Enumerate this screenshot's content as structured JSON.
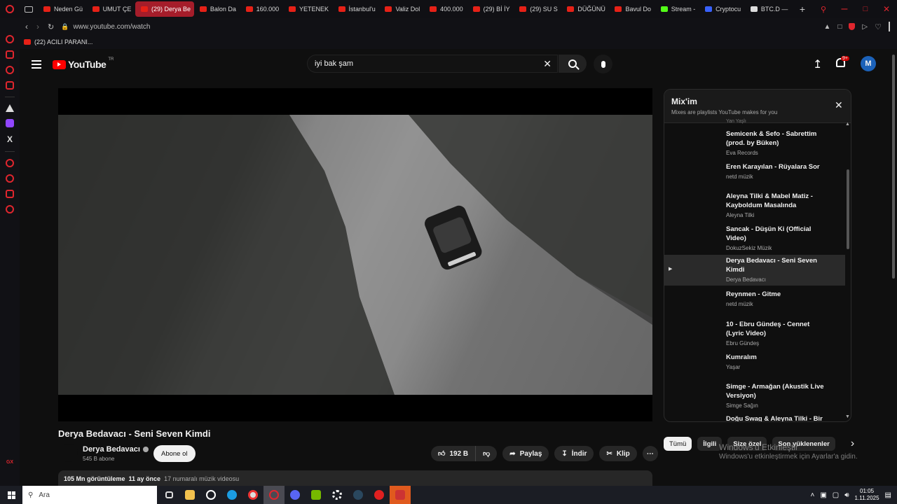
{
  "browser": {
    "tabs": [
      {
        "label": "Neden Gü"
      },
      {
        "label": "UMUT ÇE"
      },
      {
        "label": "(29) Derya Be",
        "active": true
      },
      {
        "label": "Balon Da"
      },
      {
        "label": "160.000"
      },
      {
        "label": "YETENEK"
      },
      {
        "label": "İstanbul'u"
      },
      {
        "label": "Valiz Dol"
      },
      {
        "label": "400.000"
      },
      {
        "label": "(29) Bİ İY"
      },
      {
        "label": "(29) SU S"
      },
      {
        "label": "DÜĞÜNÜ"
      },
      {
        "label": "Bavul Do"
      },
      {
        "label": "Stream -"
      },
      {
        "label": "Cryptocu"
      },
      {
        "label": "BTC.D —"
      }
    ],
    "url": "www.youtube.com/watch",
    "bookmark": "(22) ACILI PARANI..."
  },
  "youtube": {
    "logo_text": "YouTube",
    "region": "TR",
    "search_value": "iyi bak şam",
    "notification_badge": "9+",
    "avatar_letter": "M"
  },
  "video": {
    "title": "Derya Bedavacı - Seni Seven Kimdi",
    "channel": "Derya Bedavacı",
    "subscribers": "545 B abone",
    "subscribe_label": "Abone ol",
    "likes": "192 B",
    "share_label": "Paylaş",
    "download_label": "İndir",
    "clip_label": "Klip",
    "views": "105 Mn görüntüleme",
    "age": "11 ay önce",
    "rank": "17 numaralı müzik videosu"
  },
  "mix": {
    "title": "Mix'im",
    "subtitle": "Mixes are playlists YouTube makes for you",
    "partial_top": "Yan Yaşlı",
    "items": [
      {
        "title": "Semicenk & Sefo - Sabrettim (prod. by Büken)",
        "channel": "Eva Records",
        "current": false
      },
      {
        "title": "Eren Karayılan - Rüyalara Sor",
        "channel": "netd müzik",
        "current": false
      },
      {
        "title": "Aleyna Tilki & Mabel Matiz - Kayboldum Masalında",
        "channel": "Aleyna Tilki",
        "current": false
      },
      {
        "title": "Sancak - Düşün Ki (Official Video)",
        "channel": "DokuzSekiz Müzik",
        "current": false
      },
      {
        "title": "Derya Bedavacı - Seni Seven Kimdi",
        "channel": "Derya Bedavacı",
        "current": true
      },
      {
        "title": "Reynmen - Gitme",
        "channel": "netd müzik",
        "current": false
      },
      {
        "title": "10 - Ebru Gündeş - Cennet (Lyric Video)",
        "channel": "Ebru Gündeş",
        "current": false
      },
      {
        "title": "Kumralım",
        "channel": "Yaşar",
        "current": false
      },
      {
        "title": "Simge - Armağan (Akustik Live Versiyon)",
        "channel": "Simge Sağın",
        "current": false
      },
      {
        "title": "Doğu Swag & Aleyna Tilki - Bir",
        "channel": "",
        "current": false
      }
    ]
  },
  "chips": [
    "Tümü",
    "İlgili",
    "Size özel",
    "Son yüklenenler"
  ],
  "watermark": {
    "line1": "Windows'u Etkinleştir",
    "line2": "Windows'u etkinleştirmek için Ayarlar'a gidin."
  },
  "taskbar": {
    "search_placeholder": "Ara",
    "time": "01:05",
    "date": "1.11.2025"
  },
  "colors": {
    "accent": "#ff0000",
    "browser_red": "#e0262e",
    "bg": "#0f0f0f"
  }
}
